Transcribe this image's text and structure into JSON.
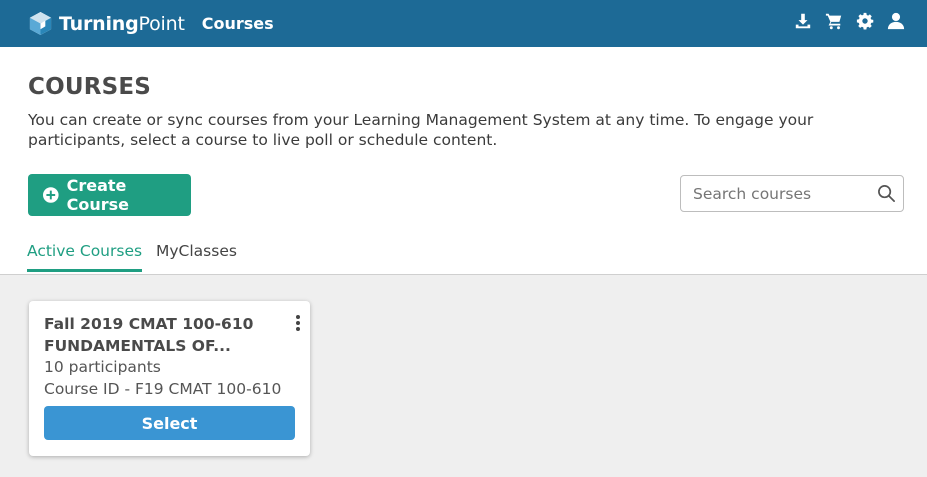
{
  "header": {
    "brand_part1": "Turning",
    "brand_part2": "Point",
    "nav_courses": "Courses",
    "icons": [
      "download-icon",
      "cart-icon",
      "gear-icon",
      "user-icon"
    ]
  },
  "page": {
    "title": "COURSES",
    "description": "You can create or sync courses from your Learning Management System at any time. To engage your participants, select a course to live poll or schedule content."
  },
  "toolbar": {
    "create_label": "Create Course",
    "search_placeholder": "Search courses"
  },
  "tabs": [
    {
      "label": "Active Courses",
      "active": true
    },
    {
      "label": "MyClasses",
      "active": false
    }
  ],
  "courses": [
    {
      "title": "Fall 2019 CMAT 100-610 FUNDAMENTALS OF...",
      "participants": "10 participants",
      "course_id": "Course ID - F19 CMAT 100-610",
      "select_label": "Select"
    }
  ],
  "colors": {
    "topbar": "#1d6a96",
    "accent_green": "#1f9e82",
    "select_blue": "#3a95d3",
    "content_bg": "#efefef"
  }
}
